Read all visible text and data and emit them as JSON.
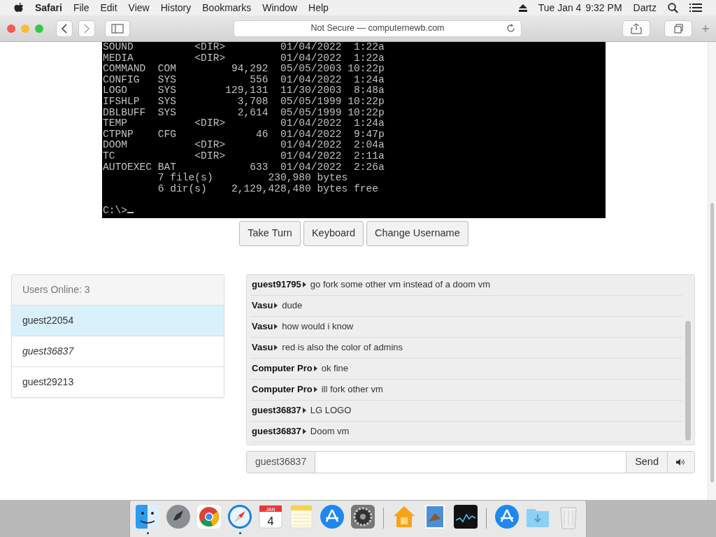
{
  "menubar": {
    "app": "Safari",
    "menus": [
      "File",
      "Edit",
      "View",
      "History",
      "Bookmarks",
      "Window",
      "Help"
    ],
    "date": "Tue Jan 4",
    "time": "9:32 PM",
    "user": "Dartz"
  },
  "toolbar": {
    "address": "Not Secure — computernewb.com"
  },
  "terminal": {
    "lines": [
      "SOUND          <DIR>         01/04/2022  1:22a",
      "MEDIA          <DIR>         01/04/2022  1:22a",
      "COMMAND  COM         94,292  05/05/2003 10:22p",
      "CONFIG   SYS            556  01/04/2022  1:24a",
      "LOGO     SYS        129,131  11/30/2003  8:48a",
      "IFSHLP   SYS          3,708  05/05/1999 10:22p",
      "DBLBUFF  SYS          2,614  05/05/1999 10:22p",
      "TEMP           <DIR>         01/04/2022  1:24a",
      "CTPNP    CFG             46  01/04/2022  9:47p",
      "DOOM           <DIR>         01/04/2022  2:04a",
      "TC             <DIR>         01/04/2022  2:11a",
      "AUTOEXEC BAT            633  01/04/2022  2:26a",
      "         7 file(s)         230,980 bytes",
      "         6 dir(s)    2,129,428,480 bytes free",
      "C:\\>"
    ]
  },
  "vm_buttons": [
    "Take Turn",
    "Keyboard",
    "Change Username"
  ],
  "users": {
    "header": "Users Online: 3",
    "items": [
      {
        "name": "guest22054",
        "selected": true,
        "self": false
      },
      {
        "name": "guest36837",
        "selected": false,
        "self": true
      },
      {
        "name": "guest29213",
        "selected": false,
        "self": false
      }
    ]
  },
  "chat": {
    "messages": [
      {
        "user": "guest91795",
        "text": "go fork some other vm instead of a doom vm"
      },
      {
        "user": "Vasu",
        "text": "dude"
      },
      {
        "user": "Vasu",
        "text": "how would i know"
      },
      {
        "user": "Vasu",
        "text": "red is also the color of admins"
      },
      {
        "user": "Computer Pro",
        "text": "ok fine"
      },
      {
        "user": "Computer Pro",
        "text": "ill fork other vm"
      },
      {
        "user": "guest36837",
        "text": "LG LOGO"
      },
      {
        "user": "guest36837",
        "text": "Doom vm"
      }
    ],
    "username": "guest36837",
    "send": "Send"
  },
  "dock": {
    "items": [
      {
        "kind": "finder",
        "running": true
      },
      {
        "kind": "rocket",
        "running": false
      },
      {
        "kind": "chrome",
        "running": false
      },
      {
        "kind": "compass",
        "running": true
      },
      {
        "kind": "calendar",
        "running": false,
        "month": "JAN",
        "day": "4"
      },
      {
        "kind": "notes",
        "running": false
      },
      {
        "kind": "appstore",
        "running": false
      },
      {
        "kind": "gear",
        "running": false
      },
      {
        "kind": "divider"
      },
      {
        "kind": "home",
        "running": false
      },
      {
        "kind": "mail",
        "running": false
      },
      {
        "kind": "stocks",
        "running": false
      },
      {
        "kind": "divider"
      },
      {
        "kind": "appstore",
        "running": false
      },
      {
        "kind": "folder",
        "running": false
      },
      {
        "kind": "trash",
        "running": false
      }
    ]
  }
}
